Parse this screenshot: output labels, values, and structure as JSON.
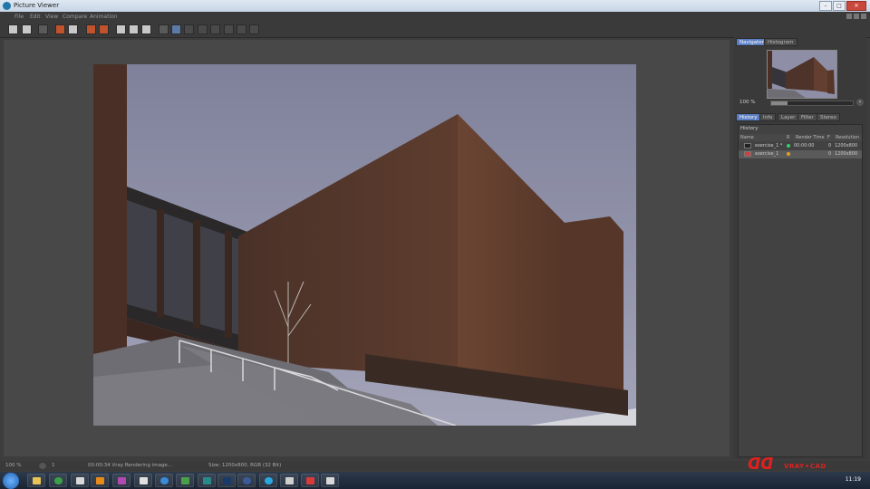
{
  "window": {
    "title": "Picture Viewer"
  },
  "menu": [
    "File",
    "Edit",
    "View",
    "Compare",
    "Animation"
  ],
  "navigator": {
    "tabs": [
      "Navigator",
      "Histogram"
    ],
    "zoom": "100 %",
    "zoom_level": 0.2
  },
  "panel_tabs": [
    "History",
    "Info",
    "Layer",
    "Filter",
    "Stereo"
  ],
  "history": {
    "title": "History",
    "columns": [
      "Name",
      "R",
      "Render Time",
      "F",
      "Resolution"
    ],
    "rows": [
      {
        "name": "exercise_1 *",
        "status_color": "#32d06a",
        "time": "00:00:00",
        "frame": "0",
        "resolution": "1200x800"
      },
      {
        "name": "exercise_1",
        "status_color": "#e0a020",
        "time": "",
        "frame": "0",
        "resolution": "1200x800"
      }
    ]
  },
  "status": {
    "zoom": "100 %",
    "frame": "1",
    "progress": "00:00:34 Vray Rendering image...",
    "size": "Size: 1200x800, RGB (32 Bit)"
  },
  "taskbar": {
    "time": "11:19"
  },
  "logo": {
    "mark": "ᗡᗡ",
    "text": "VRAY✦CAD"
  },
  "colors": {
    "accent": "#5b7ec2",
    "sky": "#8e8fa7",
    "wall": "#5a3a2c"
  }
}
